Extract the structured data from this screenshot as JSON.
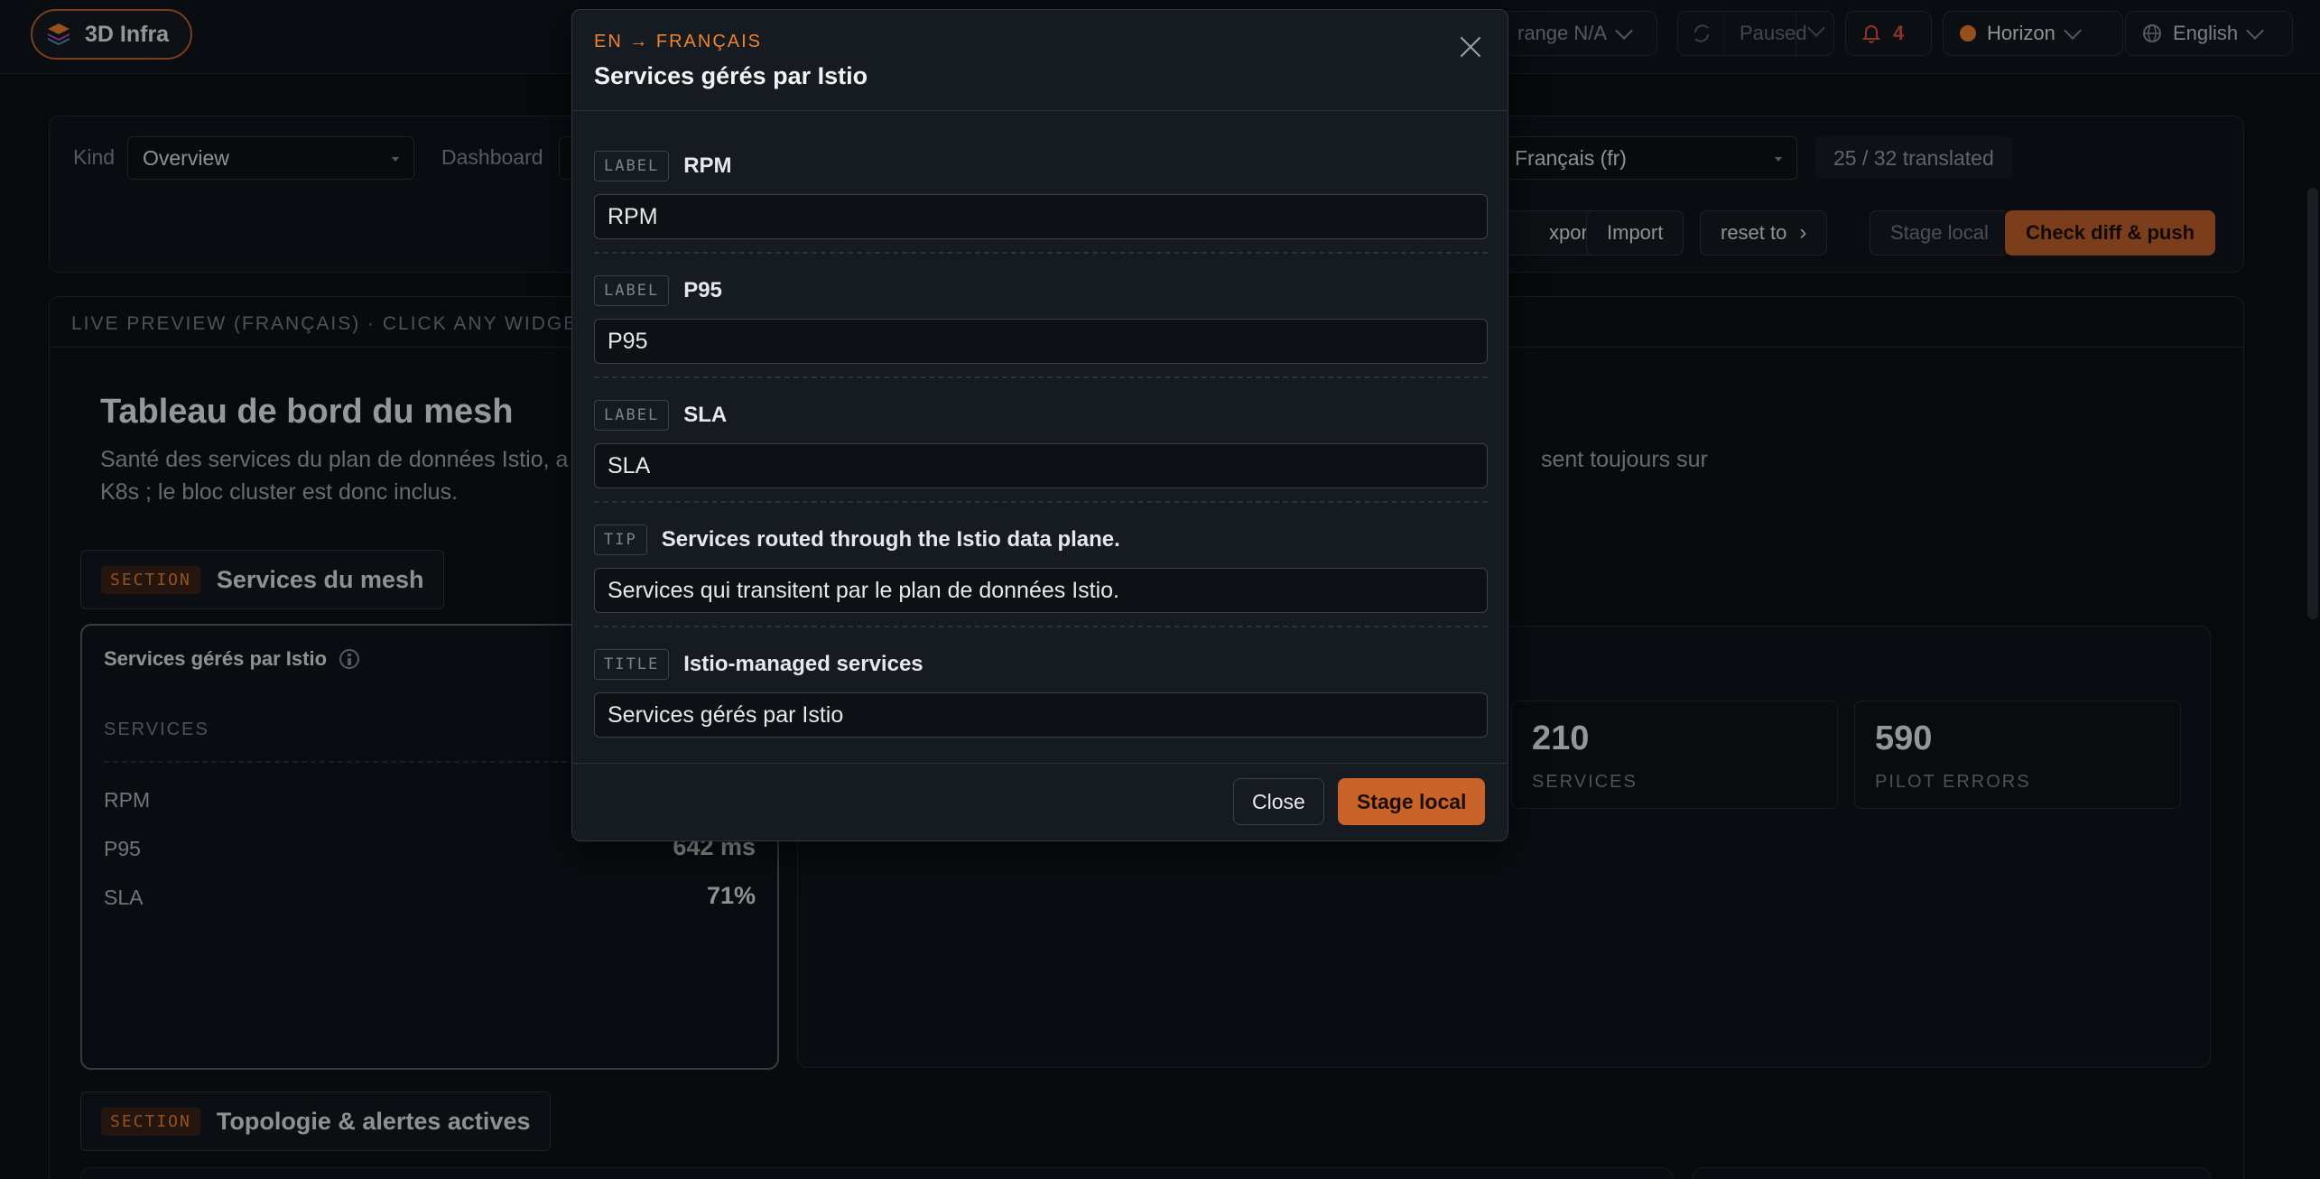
{
  "topbar": {
    "brand": "3D Infra",
    "range": "range N/A",
    "refresh": "Paused",
    "alerts_count": "4",
    "workspace": "Horizon",
    "language": "English"
  },
  "editor": {
    "kind_label": "Kind",
    "kind_value": "Overview",
    "dashboard_label": "Dashboard",
    "target_language": "Français (fr)",
    "progress": "25 / 32 translated",
    "export": "xport",
    "import": "Import",
    "reset": "reset to",
    "stage_local": "Stage local",
    "check_push": "Check diff & push"
  },
  "preview": {
    "header": "LIVE PREVIEW (FRANÇAIS) · CLICK ANY WIDGET",
    "title": "Tableau de bord du mesh",
    "desc_1": "Santé des services du plan de données Istio, a",
    "desc_1b": "sent toujours sur",
    "desc_2": "K8s ; le bloc cluster est donc inclus.",
    "section_tag": "SECTION",
    "section_1": "Services du mesh",
    "section_2": "Topologie & alertes actives",
    "card": {
      "title": "Services gérés par Istio",
      "column": "SERVICES",
      "rows": [
        {
          "label": "RPM",
          "value": ""
        },
        {
          "label": "P95",
          "value": "642 ms"
        },
        {
          "label": "SLA",
          "value": "71%"
        }
      ]
    },
    "stats": [
      {
        "value": "210",
        "label": "SERVICES"
      },
      {
        "value": "590",
        "label": "PILOT ERRORS"
      }
    ]
  },
  "modal": {
    "lang": "EN → FRANÇAIS",
    "title": "Services gérés par Istio",
    "entries": [
      {
        "kind": "LABEL",
        "source": "RPM",
        "value": "RPM"
      },
      {
        "kind": "LABEL",
        "source": "P95",
        "value": "P95"
      },
      {
        "kind": "LABEL",
        "source": "SLA",
        "value": "SLA"
      },
      {
        "kind": "TIP",
        "source": "Services routed through the Istio data plane.",
        "value": "Services qui transitent par le plan de données Istio."
      },
      {
        "kind": "TITLE",
        "source": "Istio-managed services",
        "value": "Services gérés par Istio"
      }
    ],
    "close": "Close",
    "stage_local": "Stage local"
  },
  "colors": {
    "accent": "#c9632a",
    "accent_text": "#f0822f",
    "alert": "#e0533f",
    "background": "#0c0f14"
  }
}
